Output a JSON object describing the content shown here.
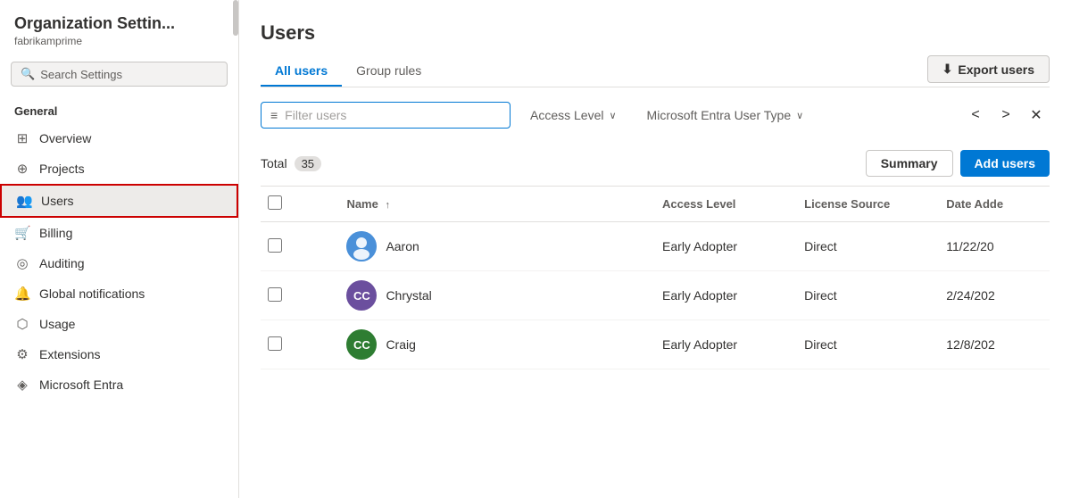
{
  "sidebar": {
    "org_title": "Organization Settin...",
    "org_sub": "fabrikamprime",
    "search_placeholder": "Search Settings",
    "section_general": "General",
    "items": [
      {
        "id": "overview",
        "label": "Overview",
        "icon": "⊞"
      },
      {
        "id": "projects",
        "label": "Projects",
        "icon": "⊕"
      },
      {
        "id": "users",
        "label": "Users",
        "icon": "👥",
        "active": true
      },
      {
        "id": "billing",
        "label": "Billing",
        "icon": "🛒"
      },
      {
        "id": "auditing",
        "label": "Auditing",
        "icon": "◎"
      },
      {
        "id": "global-notifications",
        "label": "Global notifications",
        "icon": "🔔"
      },
      {
        "id": "usage",
        "label": "Usage",
        "icon": "⬡"
      },
      {
        "id": "extensions",
        "label": "Extensions",
        "icon": "⚙"
      },
      {
        "id": "microsoft-entra",
        "label": "Microsoft Entra",
        "icon": "◈"
      }
    ]
  },
  "main": {
    "title": "Users",
    "tabs": [
      {
        "id": "all-users",
        "label": "All users",
        "active": true
      },
      {
        "id": "group-rules",
        "label": "Group rules",
        "active": false
      }
    ],
    "export_button": "Export users",
    "filter_placeholder": "Filter users",
    "dropdowns": [
      {
        "id": "access-level",
        "label": "Access Level"
      },
      {
        "id": "entra-user-type",
        "label": "Microsoft Entra User Type"
      }
    ],
    "total_label": "Total",
    "total_count": "35",
    "summary_button": "Summary",
    "add_users_button": "Add users",
    "table": {
      "columns": [
        {
          "id": "name",
          "label": "Name",
          "sort": "↑"
        },
        {
          "id": "access-level",
          "label": "Access Level"
        },
        {
          "id": "license-source",
          "label": "License Source"
        },
        {
          "id": "date-added",
          "label": "Date Adde"
        }
      ],
      "rows": [
        {
          "name": "Aaron",
          "initials": "",
          "avatar_type": "person",
          "avatar_color": "#4a90d9",
          "access_level": "Early Adopter",
          "license_source": "Direct",
          "date_added": "11/22/20"
        },
        {
          "name": "Chrystal",
          "initials": "CC",
          "avatar_type": "initials",
          "avatar_color": "#6b4f9e",
          "access_level": "Early Adopter",
          "license_source": "Direct",
          "date_added": "2/24/202"
        },
        {
          "name": "Craig",
          "initials": "CC",
          "avatar_type": "initials",
          "avatar_color": "#2e7d32",
          "access_level": "Early Adopter",
          "license_source": "Direct",
          "date_added": "12/8/202"
        }
      ]
    }
  }
}
